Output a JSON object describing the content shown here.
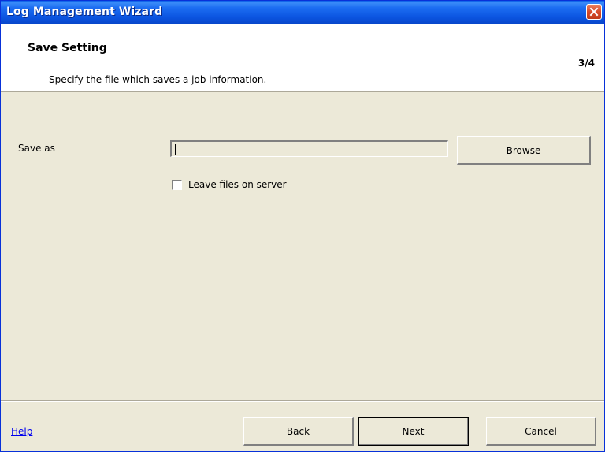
{
  "window": {
    "title": "Log Management Wizard"
  },
  "header": {
    "title": "Save Setting",
    "step": "3/4",
    "description": "Specify the file which saves a job information."
  },
  "form": {
    "save_as_label": "Save as",
    "save_as_value": "",
    "browse_label": "Browse",
    "leave_files_label": "Leave files on server",
    "leave_files_checked": false
  },
  "footer": {
    "help_label": "Help",
    "back_label": "Back",
    "next_label": "Next",
    "cancel_label": "Cancel"
  },
  "colors": {
    "titlebar": "#0b54e0",
    "close_button": "#d74a2a",
    "dialog_background": "#ece9d8",
    "header_background": "#ffffff",
    "link": "#0000ee"
  },
  "icons": {
    "close": "close-icon"
  }
}
